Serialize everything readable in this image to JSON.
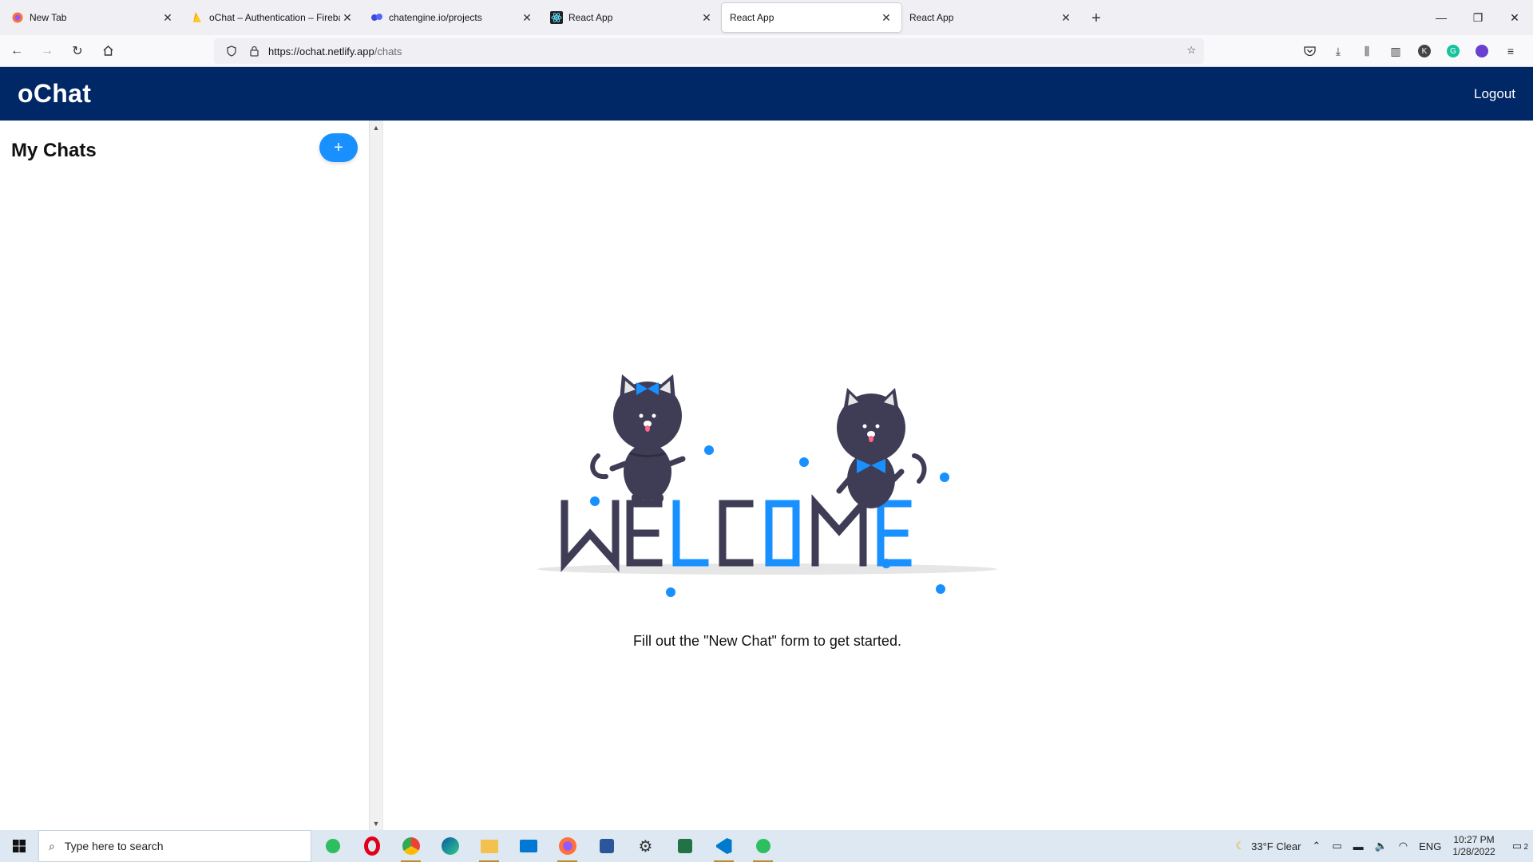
{
  "browser": {
    "tabs": [
      {
        "title": "New Tab",
        "icon": "firefox-icon"
      },
      {
        "title": "oChat – Authentication – Fireba",
        "icon": "firebase-icon"
      },
      {
        "title": "chatengine.io/projects",
        "icon": "chatengine-icon"
      },
      {
        "title": "React App",
        "icon": "react-icon"
      },
      {
        "title": "React App",
        "icon": "none",
        "active": true
      },
      {
        "title": "React App",
        "icon": "none"
      }
    ],
    "url_host": "https://ochat.netlify.app",
    "url_path": "/chats"
  },
  "app": {
    "logo": "oChat",
    "logout_label": "Logout",
    "accent_color": "#1890ff",
    "header_color": "#002766"
  },
  "sidebar": {
    "title": "My Chats",
    "add_label": "+"
  },
  "main": {
    "welcome_word": "WELCOME",
    "caption": "Fill out the \"New Chat\" form to get started."
  },
  "taskbar": {
    "search_placeholder": "Type here to search",
    "weather": "33°F  Clear",
    "lang": "ENG",
    "time": "10:27 PM",
    "date": "1/28/2022",
    "notifications": "2"
  }
}
